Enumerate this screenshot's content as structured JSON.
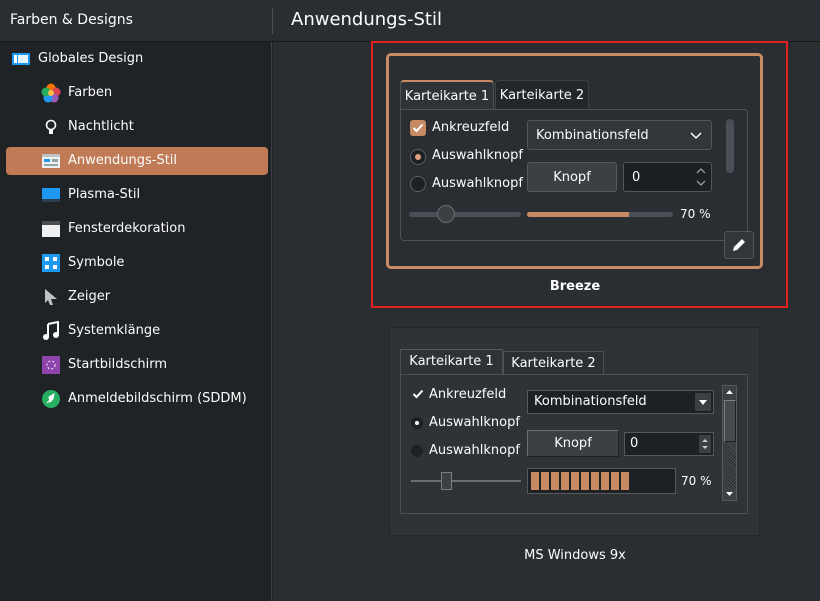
{
  "header": {
    "left_title": "Farben & Designs",
    "right_title": "Anwendungs-Stil"
  },
  "sidebar": {
    "items": [
      {
        "label": "Globales Design",
        "icon": "global-design-icon"
      },
      {
        "label": "Farben",
        "icon": "colors-icon"
      },
      {
        "label": "Nachtlicht",
        "icon": "night-light-icon"
      },
      {
        "label": "Anwendungs-Stil",
        "icon": "application-style-icon",
        "active": true
      },
      {
        "label": "Plasma-Stil",
        "icon": "plasma-style-icon"
      },
      {
        "label": "Fensterdekoration",
        "icon": "window-decoration-icon"
      },
      {
        "label": "Symbole",
        "icon": "icons-icon"
      },
      {
        "label": "Zeiger",
        "icon": "cursor-icon"
      },
      {
        "label": "Systemklänge",
        "icon": "system-sounds-icon"
      },
      {
        "label": "Startbildschirm",
        "icon": "splash-screen-icon"
      },
      {
        "label": "Anmeldebildschirm (SDDM)",
        "icon": "login-screen-icon"
      }
    ]
  },
  "styles": [
    {
      "name": "Breeze",
      "selected": true,
      "tabs": [
        "Karteikarte 1",
        "Karteikarte 2"
      ],
      "checkbox_label": "Ankreuzfeld",
      "radio_labels": [
        "Auswahlknopf",
        "Auswahlknopf"
      ],
      "combo_value": "Kombinationsfeld",
      "button_label": "Knopf",
      "spin_value": "0",
      "progress_label": "70 %",
      "progress": 0.7,
      "slider": 0.25
    },
    {
      "name": "MS Windows 9x",
      "selected": false,
      "tabs": [
        "Karteikarte 1",
        "Karteikarte 2"
      ],
      "checkbox_label": "Ankreuzfeld",
      "radio_labels": [
        "Auswahlknopf",
        "Auswahlknopf"
      ],
      "combo_value": "Kombinationsfeld",
      "button_label": "Knopf",
      "spin_value": "0",
      "progress_label": "70 %",
      "progress": 0.7,
      "slider": 0.3
    }
  ],
  "colors": {
    "accent": "#c88a62",
    "selection_frame": "#e31f1f",
    "sidebar_active": "#c07b56"
  }
}
